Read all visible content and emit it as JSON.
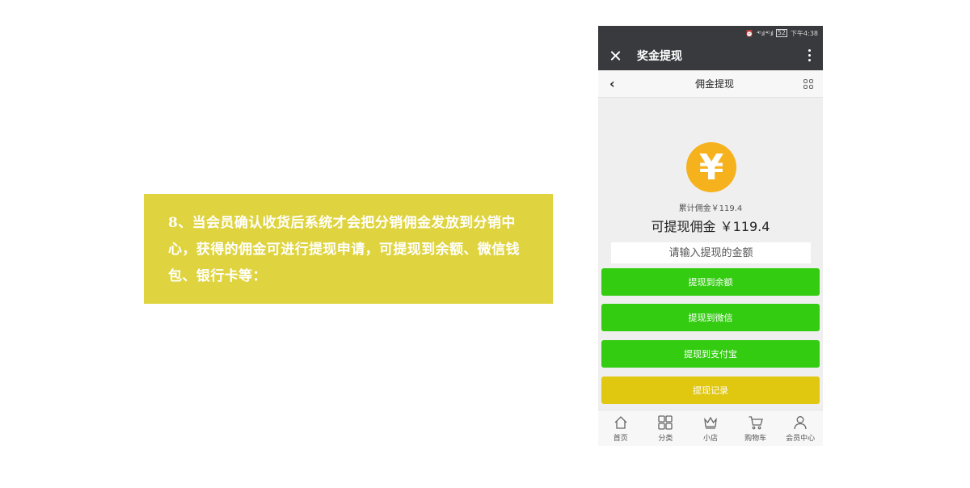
{
  "caption": {
    "text": "8、当会员确认收货后系统才会把分销佣金发放到分销中心，获得的佣金可进行提现申请，可提现到余额、微信钱包、银行卡等："
  },
  "status_bar": {
    "signal": "⁴ᴳ.ıl ⁴ᴳ.ıl",
    "battery": "52",
    "time": "下午4:38"
  },
  "title_bar": {
    "title": "奖金提现"
  },
  "nav_bar": {
    "back": "‹",
    "title": "佣金提现"
  },
  "main": {
    "coin_symbol": "¥",
    "total_commission": "累计佣金￥119.4",
    "available_commission": "可提现佣金 ￥119.4",
    "amount_placeholder": "请输入提现的金额",
    "buttons": [
      {
        "label": "提现到余额",
        "color": "#33cc11"
      },
      {
        "label": "提现到微信",
        "color": "#33cc11"
      },
      {
        "label": "提现到支付宝",
        "color": "#33cc11"
      },
      {
        "label": "提现记录",
        "color": "#e0c710"
      }
    ]
  },
  "tab_bar": {
    "items": [
      {
        "label": "首页",
        "icon": "home-icon"
      },
      {
        "label": "分类",
        "icon": "category-grid-icon"
      },
      {
        "label": "小店",
        "icon": "crown-icon"
      },
      {
        "label": "购物车",
        "icon": "cart-icon"
      },
      {
        "label": "会员中心",
        "icon": "user-icon"
      }
    ]
  }
}
